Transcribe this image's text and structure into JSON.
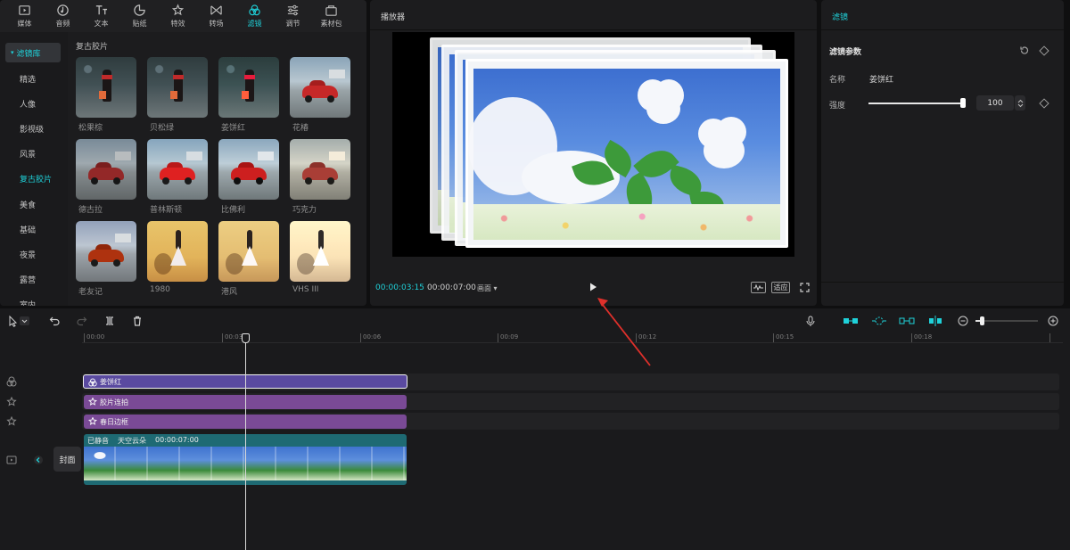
{
  "top_tabs": [
    {
      "label": "媒体",
      "icon": "media-icon"
    },
    {
      "label": "音频",
      "icon": "audio-icon"
    },
    {
      "label": "文本",
      "icon": "text-icon"
    },
    {
      "label": "贴纸",
      "icon": "sticker-icon"
    },
    {
      "label": "特效",
      "icon": "effects-icon"
    },
    {
      "label": "转场",
      "icon": "transition-icon"
    },
    {
      "label": "滤镜",
      "icon": "filter-icon",
      "active": true
    },
    {
      "label": "调节",
      "icon": "adjust-icon"
    },
    {
      "label": "素材包",
      "icon": "asset-pack-icon"
    }
  ],
  "filter_nav": {
    "header": "滤镜库",
    "items": [
      "精选",
      "人像",
      "影视级",
      "风景",
      "复古胶片",
      "美食",
      "基础",
      "夜景",
      "露营",
      "室内"
    ],
    "selected": "复古胶片"
  },
  "filter_grid": {
    "title": "复古胶片",
    "items": [
      "松果棕",
      "贝松绿",
      "姜饼红",
      "花椿",
      "德古拉",
      "普林斯顿",
      "比佛利",
      "巧克力",
      "老友记",
      "1980",
      "港风",
      "VHS III"
    ]
  },
  "player": {
    "title": "播放器",
    "current_time": "00:00:03:15",
    "total_time": "00:00:07:00",
    "ratio_label": "画面",
    "adapt_label": "适应"
  },
  "filter_props": {
    "title": "滤镜",
    "section": "滤镜参数",
    "name_label": "名称",
    "name_value": "姜饼红",
    "strength_label": "强度",
    "strength_value": "100",
    "strength_fraction": 1.0
  },
  "ruler": [
    "00:00",
    "00:03",
    "00:06",
    "00:09",
    "00:12",
    "00:15",
    "00:18"
  ],
  "timeline": {
    "filter_clip": "姜饼红",
    "effect_clip_1": "胶片连拍",
    "effect_clip_2": "春日边框",
    "video_mute": "已静音",
    "video_name": "天空云朵",
    "video_duration": "00:00:07:00",
    "cover_label": "封面"
  },
  "colors": {
    "accent": "#1fd1d9",
    "filter_clip": "#5a4aa0",
    "effect_clip": "#7a4a96",
    "video_clip": "#1e6a73"
  }
}
